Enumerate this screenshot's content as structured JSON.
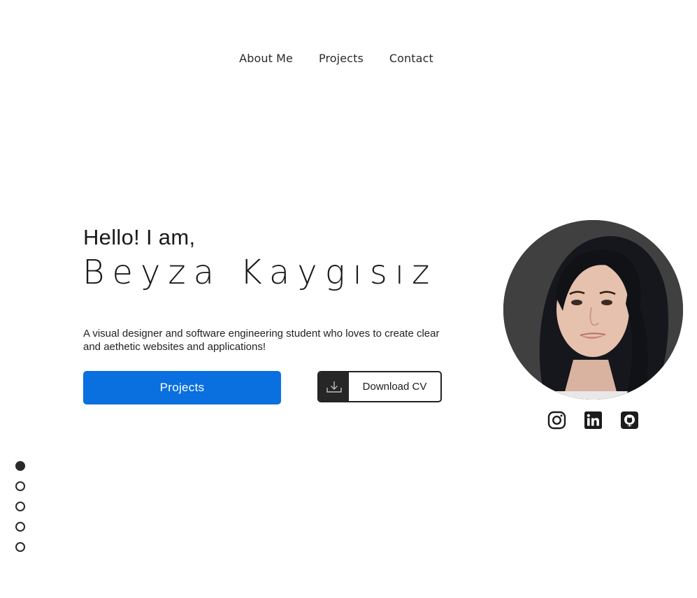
{
  "nav": {
    "items": [
      {
        "label": "About Me"
      },
      {
        "label": "Projects"
      },
      {
        "label": "Contact"
      }
    ]
  },
  "hero": {
    "greeting": "Hello! I am,",
    "name": "Beyza Kaygısız",
    "tagline": "A visual designer and software engineering student who loves to create clear and aethetic websites and applications!",
    "projects_button": "Projects",
    "cv_button": "Download CV",
    "cv_icon": "download-icon",
    "accent_color": "#0a6fdf"
  },
  "avatar": {
    "icon": "profile-photo"
  },
  "socials": [
    {
      "icon": "instagram-icon"
    },
    {
      "icon": "linkedin-icon"
    },
    {
      "icon": "github-icon"
    }
  ],
  "section_dots": {
    "count": 5,
    "active_index": 0
  }
}
